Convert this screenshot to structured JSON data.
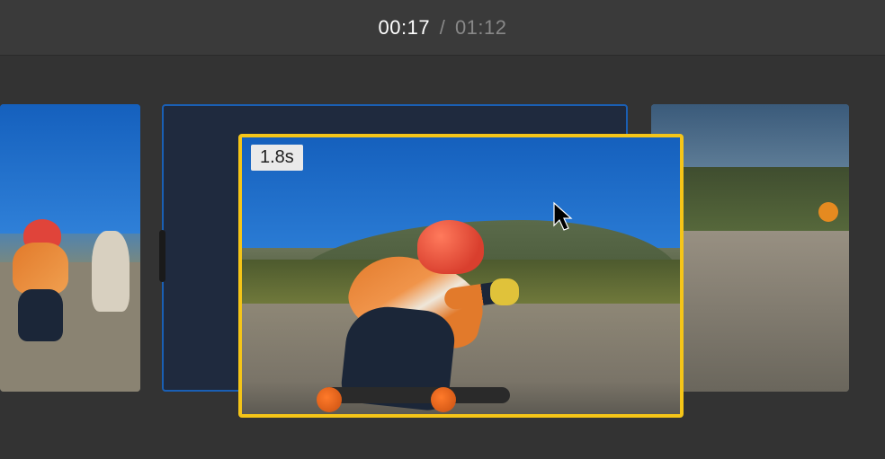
{
  "playhead": {
    "current": "00:17",
    "total": "01:12",
    "separator": "/"
  },
  "selected_clip": {
    "duration_label": "1.8s"
  }
}
